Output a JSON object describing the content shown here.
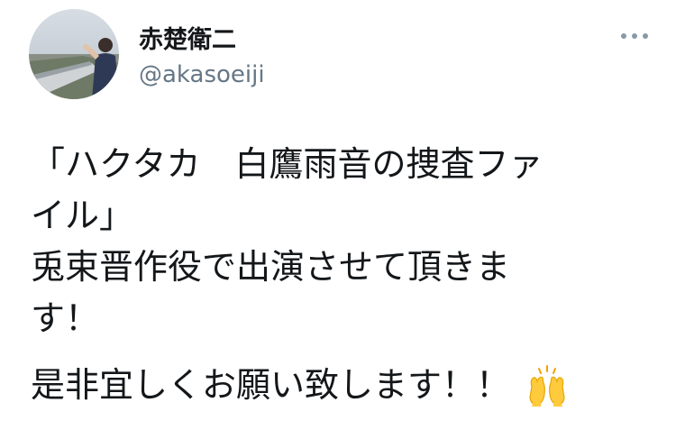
{
  "tweet": {
    "author": {
      "display_name": "赤楚衛二",
      "handle": "@akasoeiji"
    },
    "more_icon": "more-horizontal-icon",
    "text_lines": [
      "「ハクタカ　白鷹雨音の捜査ファ",
      "イル」",
      "兎束晋作役で出演させて頂きま",
      "す！"
    ],
    "closing_line": "是非宜しくお願い致します！！",
    "closing_emoji": "raising-hands-emoji"
  }
}
